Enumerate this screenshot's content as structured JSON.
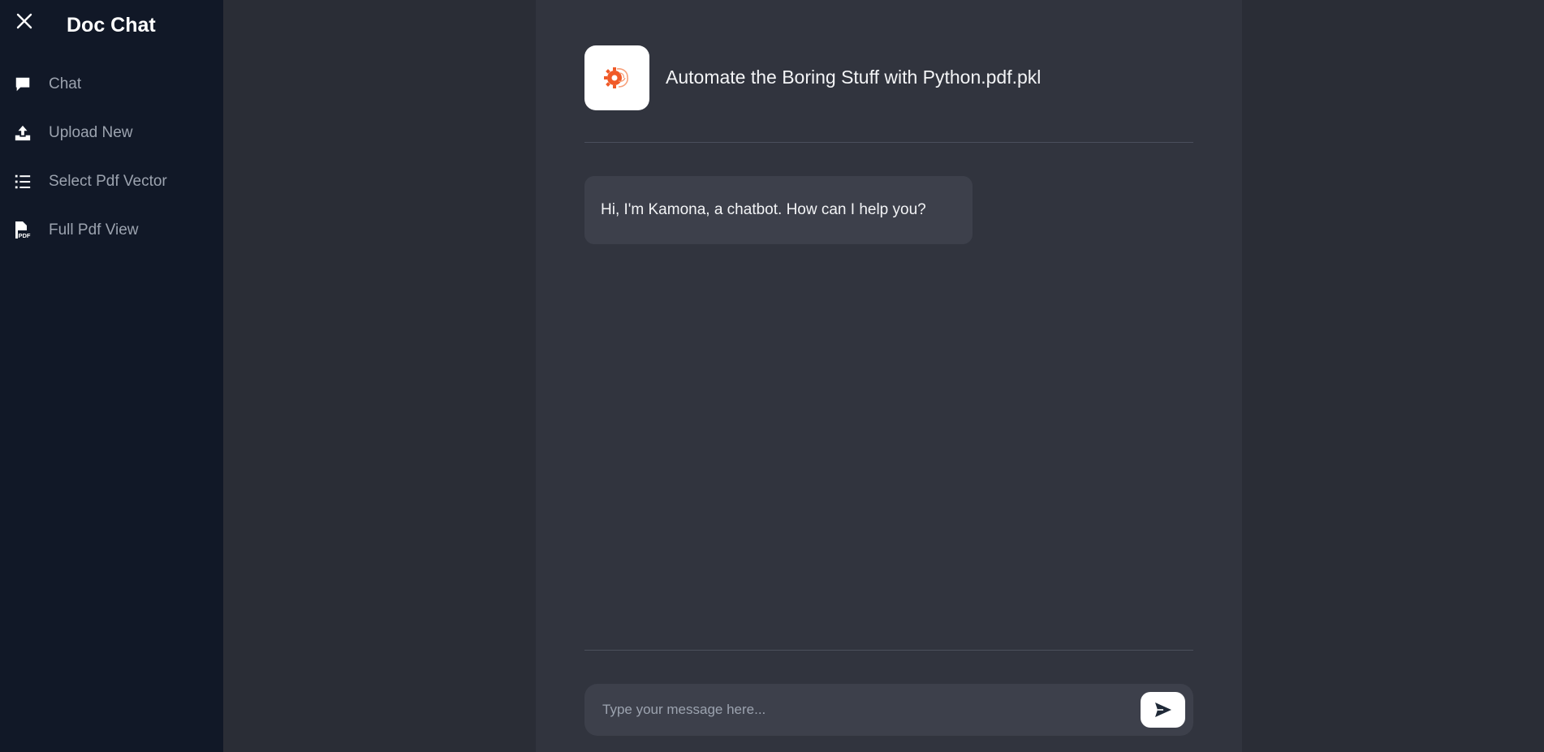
{
  "sidebar": {
    "title": "Doc Chat",
    "close_icon": "close-icon",
    "items": [
      {
        "label": "Chat",
        "icon": "chat-bubble-icon"
      },
      {
        "label": "Upload New",
        "icon": "upload-icon"
      },
      {
        "label": "Select Pdf Vector",
        "icon": "list-icon"
      },
      {
        "label": "Full Pdf View",
        "icon": "pdf-file-icon"
      }
    ]
  },
  "chat": {
    "logo_icon": "brain-gear-icon",
    "document_title": "Automate the Boring Stuff with Python.pdf.pkl",
    "messages": [
      {
        "sender": "bot",
        "text": "Hi, I'm Kamona, a chatbot. How can I help you?"
      }
    ],
    "input": {
      "placeholder": "Type your message here...",
      "value": ""
    },
    "send_icon": "send-icon"
  },
  "colors": {
    "sidebar_bg": "#111827",
    "page_bg": "#2a2d36",
    "panel_bg": "#31343e",
    "bubble_bg": "#3d404b",
    "accent": "#f05a28"
  }
}
